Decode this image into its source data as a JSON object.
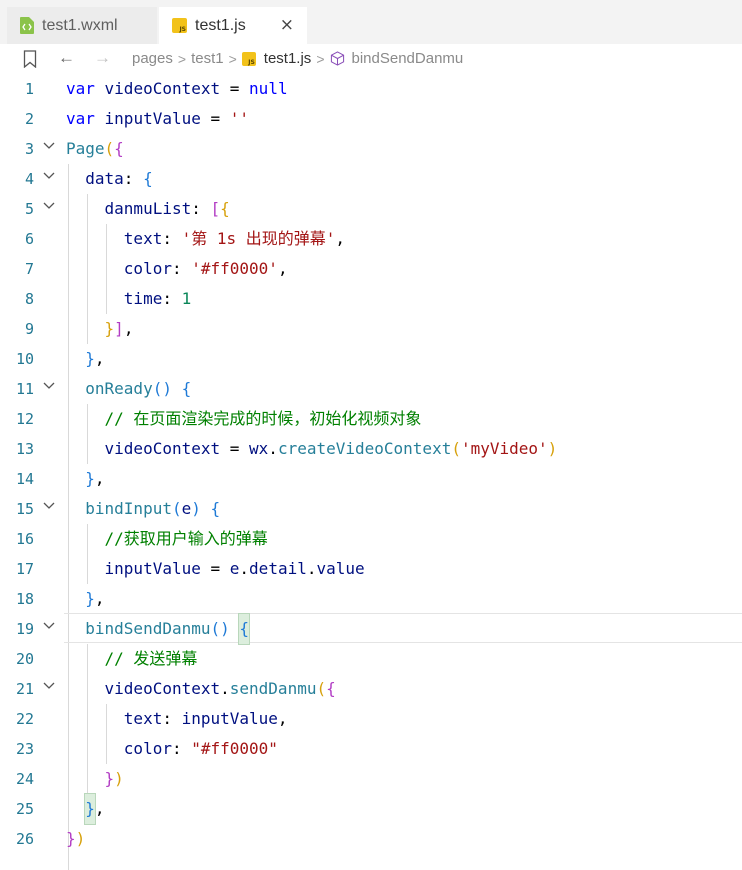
{
  "tabs": [
    {
      "label": "test1.wxml",
      "active": false
    },
    {
      "label": "test1.js",
      "active": true
    }
  ],
  "tab_close": "×",
  "breadcrumb": {
    "items": [
      "pages",
      "test1",
      "test1.js",
      "bindSendDanmu"
    ],
    "separator": ">"
  },
  "icons": {
    "wxml": "wxml-file-icon",
    "js": "js-file-icon",
    "js_badge": "JS",
    "bookmark": "bookmark-icon",
    "back": "←",
    "forward": "→",
    "method": "method-cube-icon",
    "fold": "chevron-down-icon"
  },
  "colors": {
    "keyword": "#0000ff",
    "variable": "#001080",
    "function": "#795e26",
    "string": "#a31515",
    "number": "#098658",
    "comment": "#008000",
    "line_number": "#237893",
    "bracket_gold": "#d7a10c",
    "bracket_purple": "#b23cc4",
    "bracket_blue": "#1f7ad6"
  },
  "lines": [
    {
      "n": "1",
      "text": "var videoContext = null"
    },
    {
      "n": "2",
      "text": "var inputValue = ''"
    },
    {
      "n": "3",
      "text": "Page({"
    },
    {
      "n": "4",
      "text": "  data: {"
    },
    {
      "n": "5",
      "text": "    danmuList: [{"
    },
    {
      "n": "6",
      "text": "      text: '第 1s 出现的弹幕',"
    },
    {
      "n": "7",
      "text": "      color: '#ff0000',"
    },
    {
      "n": "8",
      "text": "      time: 1"
    },
    {
      "n": "9",
      "text": "    }],"
    },
    {
      "n": "10",
      "text": "  },"
    },
    {
      "n": "11",
      "text": "  onReady() {"
    },
    {
      "n": "12",
      "text": "    // 在页面渲染完成的时候，初始化视频对象"
    },
    {
      "n": "13",
      "text": "    videoContext = wx.createVideoContext('myVideo')"
    },
    {
      "n": "14",
      "text": "  },"
    },
    {
      "n": "15",
      "text": "  bindInput(e) {"
    },
    {
      "n": "16",
      "text": "    //获取用户输入的弹幕"
    },
    {
      "n": "17",
      "text": "    inputValue = e.detail.value"
    },
    {
      "n": "18",
      "text": "  },"
    },
    {
      "n": "19",
      "text": "  bindSendDanmu() {"
    },
    {
      "n": "20",
      "text": "    // 发送弹幕"
    },
    {
      "n": "21",
      "text": "    videoContext.sendDanmu({"
    },
    {
      "n": "22",
      "text": "      text: inputValue,"
    },
    {
      "n": "23",
      "text": "      color: \"#ff0000\""
    },
    {
      "n": "24",
      "text": "    })"
    },
    {
      "n": "25",
      "text": "  },"
    },
    {
      "n": "26",
      "text": "})"
    }
  ],
  "tokens": {
    "l1": [
      "var",
      " videoContext",
      " = ",
      "null"
    ],
    "l2": [
      "var",
      " inputValue",
      " = ",
      "''"
    ],
    "l3": [
      "Page",
      "(",
      "{"
    ],
    "l4": [
      "data",
      ": ",
      "{"
    ],
    "l5": [
      "danmuList",
      ": ",
      "[",
      "{"
    ],
    "l6": [
      "text",
      ": ",
      "'第 1s 出现的弹幕'",
      ","
    ],
    "l7": [
      "color",
      ": ",
      "'#ff0000'",
      ","
    ],
    "l8": [
      "time",
      ": ",
      "1"
    ],
    "l9": [
      "}",
      "]",
      ","
    ],
    "l10": [
      "}",
      ","
    ],
    "l11": [
      "onReady",
      "(",
      ")",
      " ",
      "{"
    ],
    "l12": [
      "// 在页面渲染完成的时候，初始化视频对象"
    ],
    "l13": [
      "videoContext",
      " = ",
      "wx",
      ".",
      "createVideoContext",
      "(",
      "'myVideo'",
      ")"
    ],
    "l14": [
      "}",
      ","
    ],
    "l15": [
      "bindInput",
      "(",
      "e",
      ")",
      " ",
      "{"
    ],
    "l16": [
      "//获取用户输入的弹幕"
    ],
    "l17": [
      "inputValue",
      " = ",
      "e",
      ".",
      "detail",
      ".",
      "value"
    ],
    "l18": [
      "}",
      ","
    ],
    "l19": [
      "bindSendDanmu",
      "(",
      ")",
      " ",
      "{"
    ],
    "l20": [
      "// 发送弹幕"
    ],
    "l21": [
      "videoContext",
      ".",
      "sendDanmu",
      "(",
      "{"
    ],
    "l22": [
      "text",
      ": ",
      "inputValue",
      ","
    ],
    "l23": [
      "color",
      ": ",
      "\"#ff0000\""
    ],
    "l24": [
      "}",
      ")"
    ],
    "l25": [
      "}",
      ","
    ],
    "l26": [
      "}",
      ")"
    ]
  }
}
